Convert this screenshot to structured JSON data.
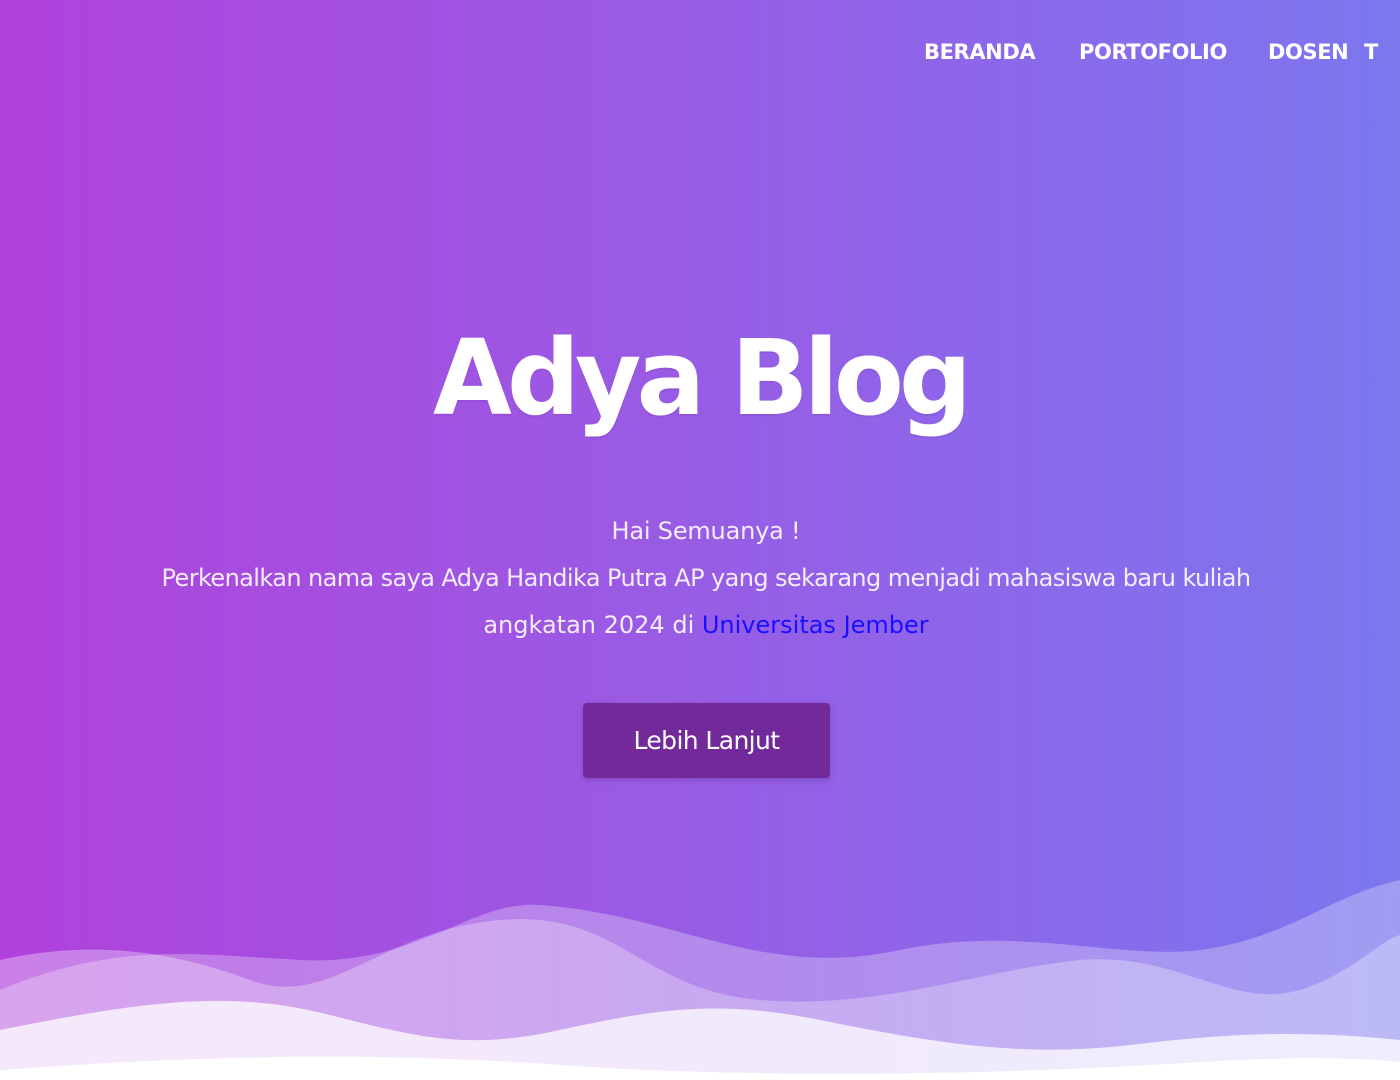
{
  "nav": {
    "items": [
      {
        "label": "BERANDA"
      },
      {
        "label": "PORTOFOLIO"
      },
      {
        "label": "DOSEN"
      },
      {
        "label": "T"
      }
    ]
  },
  "hero": {
    "title": "Adya Blog",
    "greeting": "Hai Semuanya !",
    "intro_line1": "Perkenalkan nama saya Adya Handika Putra AP yang sekarang menjadi mahasiswa baru kuliah",
    "intro_line2_prefix": "angkatan 2024 di ",
    "university_link": "Universitas Jember",
    "cta_label": "Lebih Lanjut"
  },
  "colors": {
    "gradient_start": "#b042dc",
    "gradient_end": "#7b78ee",
    "button_bg": "#722a9a",
    "link": "#1a10ff",
    "text": "#ffffff"
  }
}
